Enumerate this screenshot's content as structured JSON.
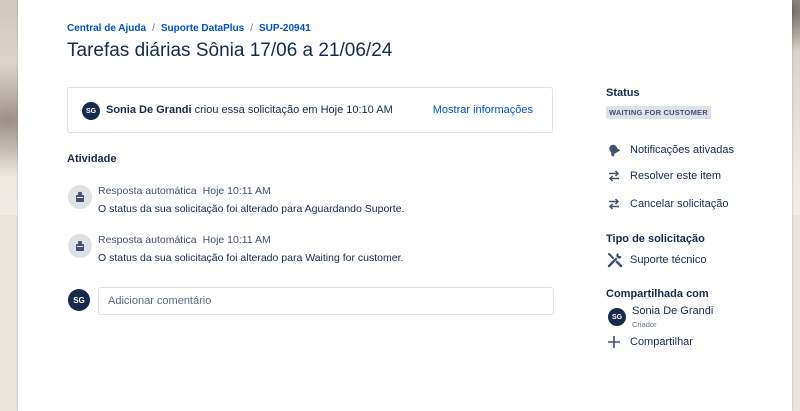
{
  "breadcrumb": {
    "items": [
      "Central de Ajuda",
      "Suporte DataPlus",
      "SUP-20941"
    ],
    "separator": "/"
  },
  "title": "Tarefas diárias Sônia 17/06 a 21/06/24",
  "request_info": {
    "avatar_initials": "SG",
    "author": "Sonia De Grandi",
    "text": "criou essa solicitação em Hoje 10:10 AM",
    "show_more": "Mostrar informações"
  },
  "activity": {
    "heading": "Atividade",
    "items": [
      {
        "author": "Resposta automática",
        "time": "Hoje 10:11 AM",
        "message": "O status da sua solicitação foi alterado para Aguardando Suporte."
      },
      {
        "author": "Resposta automática",
        "time": "Hoje 10:11 AM",
        "message": "O status da sua solicitação foi alterado para Waiting for customer."
      }
    ]
  },
  "comment": {
    "avatar_initials": "SG",
    "placeholder": "Adicionar comentário"
  },
  "sidebar": {
    "status_heading": "Status",
    "status_value": "WAITING FOR CUSTOMER",
    "actions": [
      {
        "label": "Notificações ativadas",
        "icon": "bell-icon"
      },
      {
        "label": "Resolver este item",
        "icon": "transition-arrows-icon"
      },
      {
        "label": "Cancelar solicitação",
        "icon": "transition-arrows-icon"
      }
    ],
    "request_type_heading": "Tipo de solicitação",
    "request_type_value": "Suporte técnico",
    "shared_heading": "Compartilhada com",
    "shared_user": {
      "initials": "SG",
      "name": "Sonia De Grandi",
      "role": "Criador"
    },
    "share_label": "Compartilhar"
  },
  "colors": {
    "link": "#0052cc",
    "text": "#172b4d",
    "avatar": "#172b4d",
    "badge_bg": "#dfe1e6"
  }
}
